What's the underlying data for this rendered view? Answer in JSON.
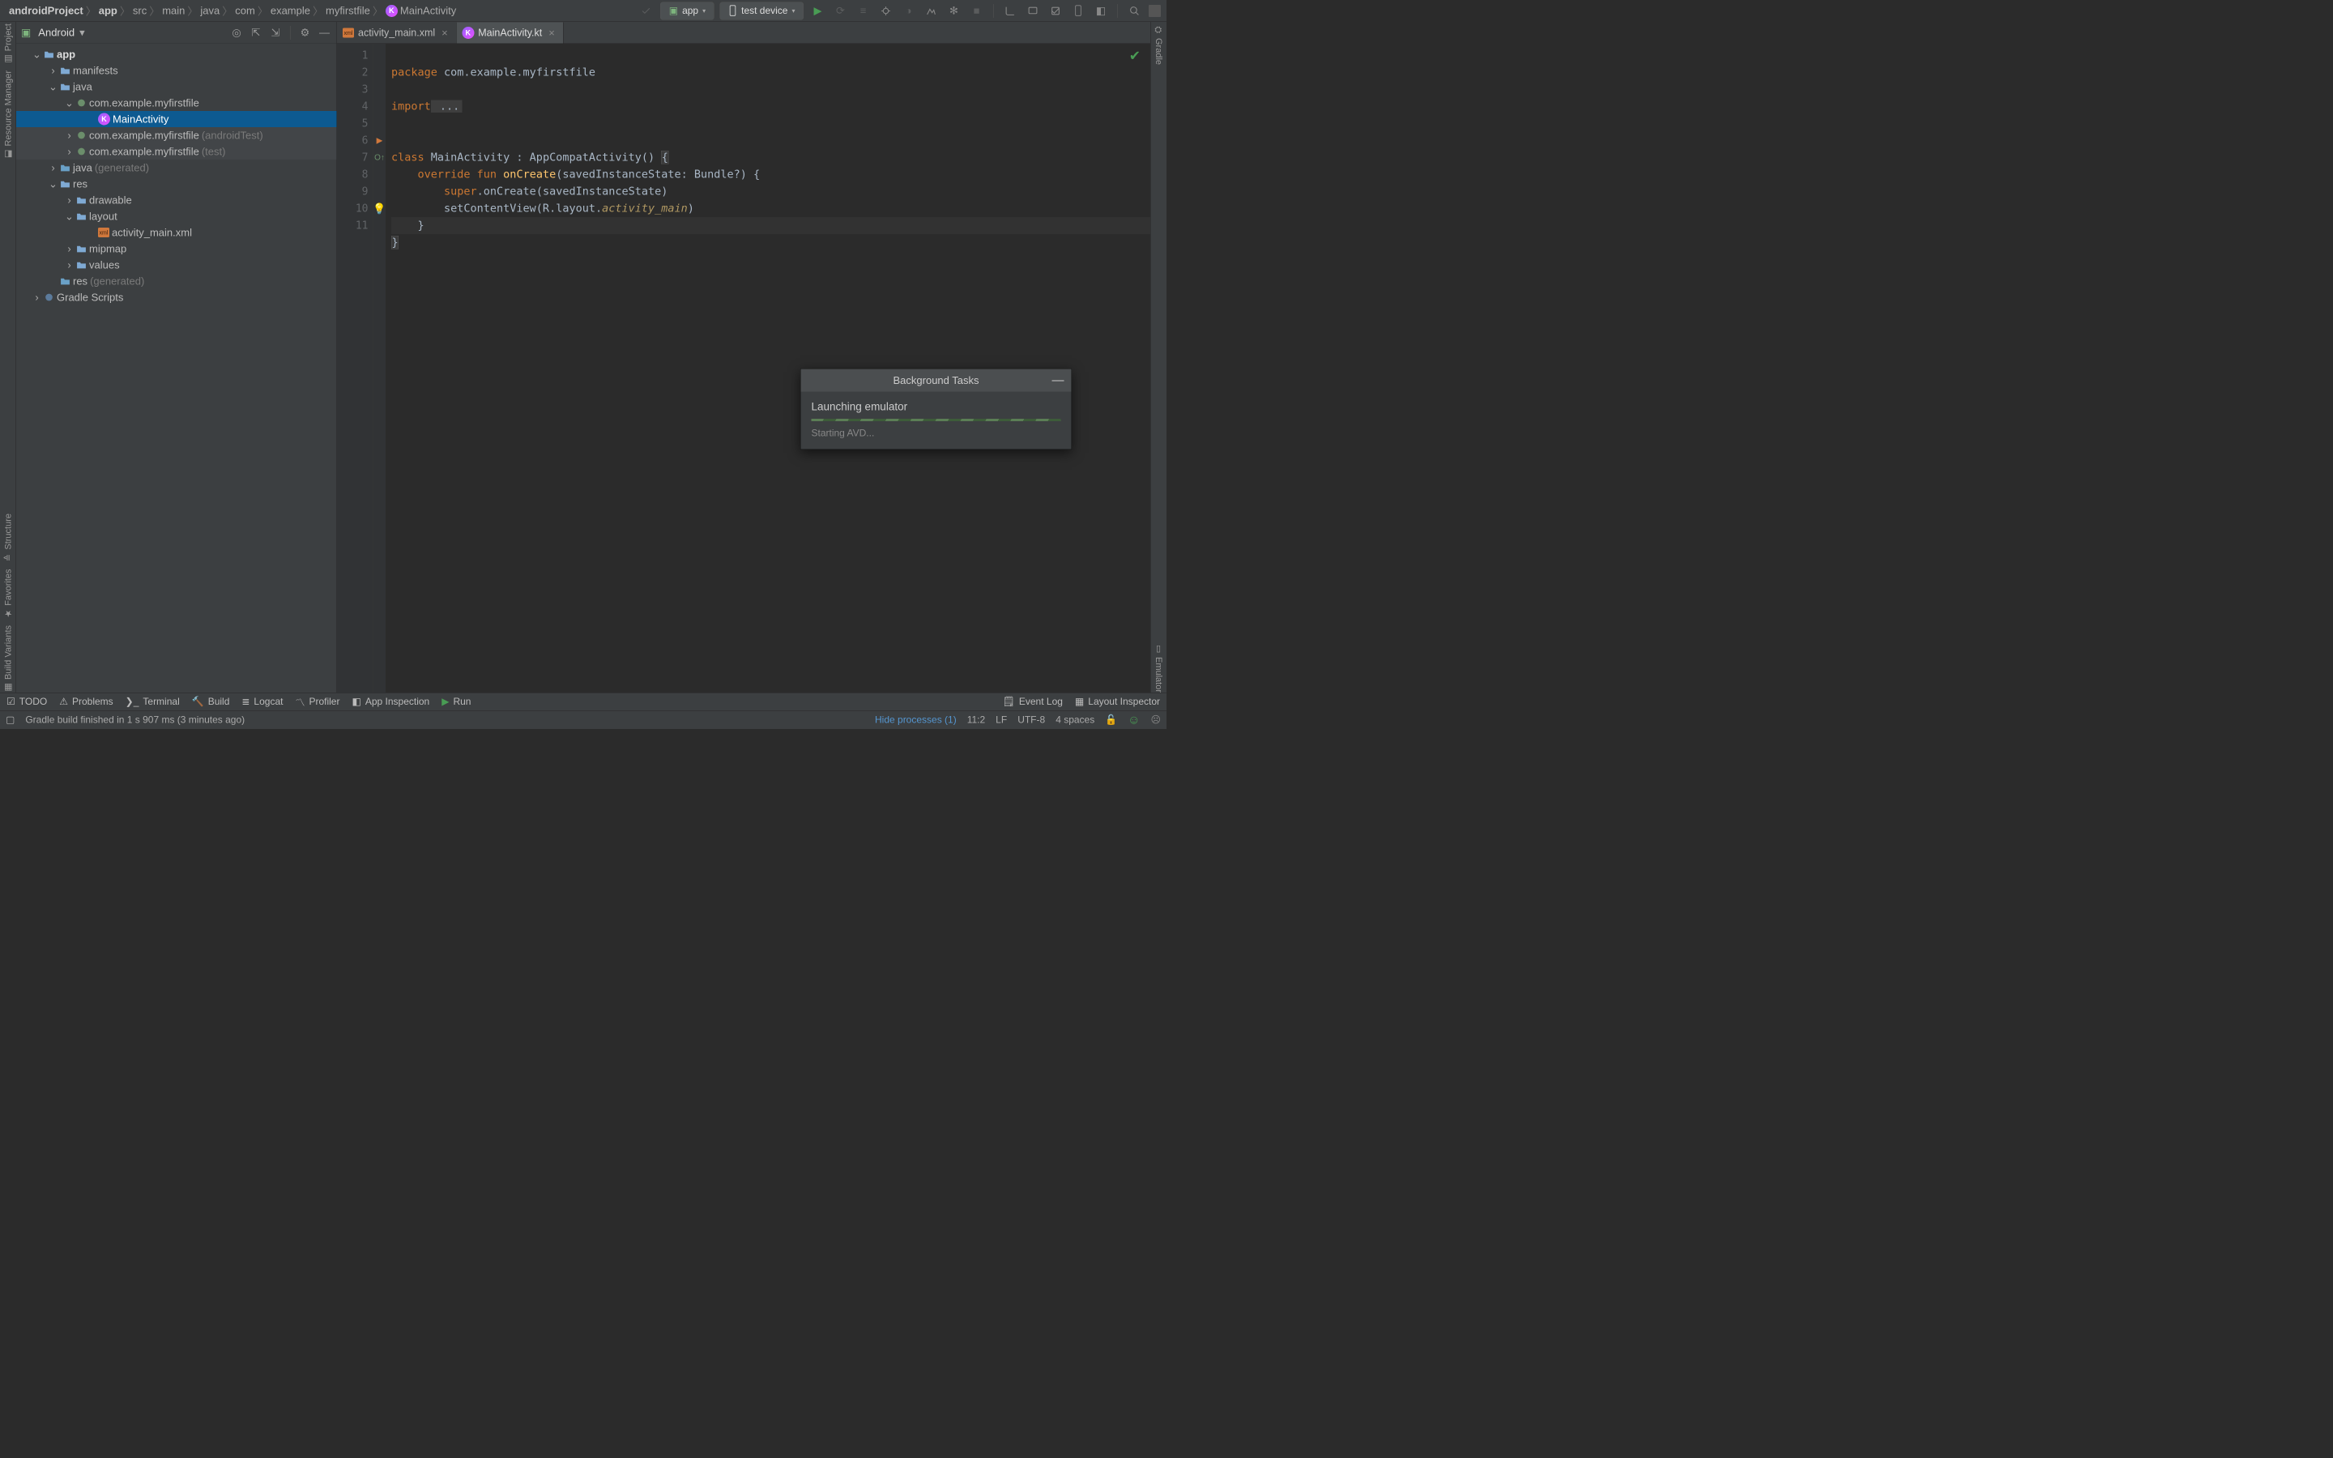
{
  "breadcrumb": [
    "androidProject",
    "app",
    "src",
    "main",
    "java",
    "com",
    "example",
    "myfirstfile",
    "MainActivity"
  ],
  "toolbar": {
    "run_config": "app",
    "device": "test device"
  },
  "project": {
    "view_label": "Android",
    "tree": {
      "app": "app",
      "manifests": "manifests",
      "java": "java",
      "pkg": "com.example.myfirstfile",
      "main_activity": "MainActivity",
      "pkg_androidTest": "com.example.myfirstfile",
      "pkg_androidTest_suffix": "(androidTest)",
      "pkg_test": "com.example.myfirstfile",
      "pkg_test_suffix": "(test)",
      "java_gen": "java",
      "java_gen_suffix": "(generated)",
      "res": "res",
      "drawable": "drawable",
      "layout": "layout",
      "layout_file": "activity_main.xml",
      "mipmap": "mipmap",
      "values": "values",
      "res_gen": "res",
      "res_gen_suffix": "(generated)",
      "gradle_scripts": "Gradle Scripts"
    }
  },
  "left_tabs": [
    "Project",
    "Resource Manager",
    "Structure",
    "Favorites",
    "Build Variants"
  ],
  "right_tabs": [
    "Gradle",
    "Emulator"
  ],
  "editor": {
    "tabs": [
      {
        "label": "activity_main.xml",
        "icon": "xml"
      },
      {
        "label": "MainActivity.kt",
        "icon": "kt"
      }
    ],
    "line_numbers": [
      "1",
      "2",
      "3",
      "4",
      "5",
      "6",
      "7",
      "8",
      "9",
      "10",
      "11"
    ],
    "code": {
      "l1a": "package",
      "l1b": " com.example.myfirstfile",
      "l3a": "import",
      "l3b": " ...",
      "l6a": "class",
      "l6b": " MainActivity : AppCompatActivity() ",
      "l6c": "{",
      "l7a": "    override",
      "l7b": " fun",
      "l7c": " onCreate",
      "l7d": "(savedInstanceState: Bundle?) {",
      "l8a": "        super",
      "l8b": ".onCreate(savedInstanceState)",
      "l9a": "        setContentView(R.layout.",
      "l9b": "activity_main",
      "l9c": ")",
      "l10": "    }",
      "l11": "}"
    }
  },
  "bg_tasks": {
    "title": "Background Tasks",
    "task": "Launching emulator",
    "sub": "Starting AVD..."
  },
  "bottom_tools": [
    "TODO",
    "Problems",
    "Terminal",
    "Build",
    "Logcat",
    "Profiler",
    "App Inspection",
    "Run",
    "Event Log",
    "Layout Inspector"
  ],
  "status": {
    "msg": "Gradle build finished in 1 s 907 ms (3 minutes ago)",
    "hide": "Hide processes (1)",
    "cursor": "11:2",
    "sep": "LF",
    "enc": "UTF-8",
    "indent": "4 spaces"
  }
}
